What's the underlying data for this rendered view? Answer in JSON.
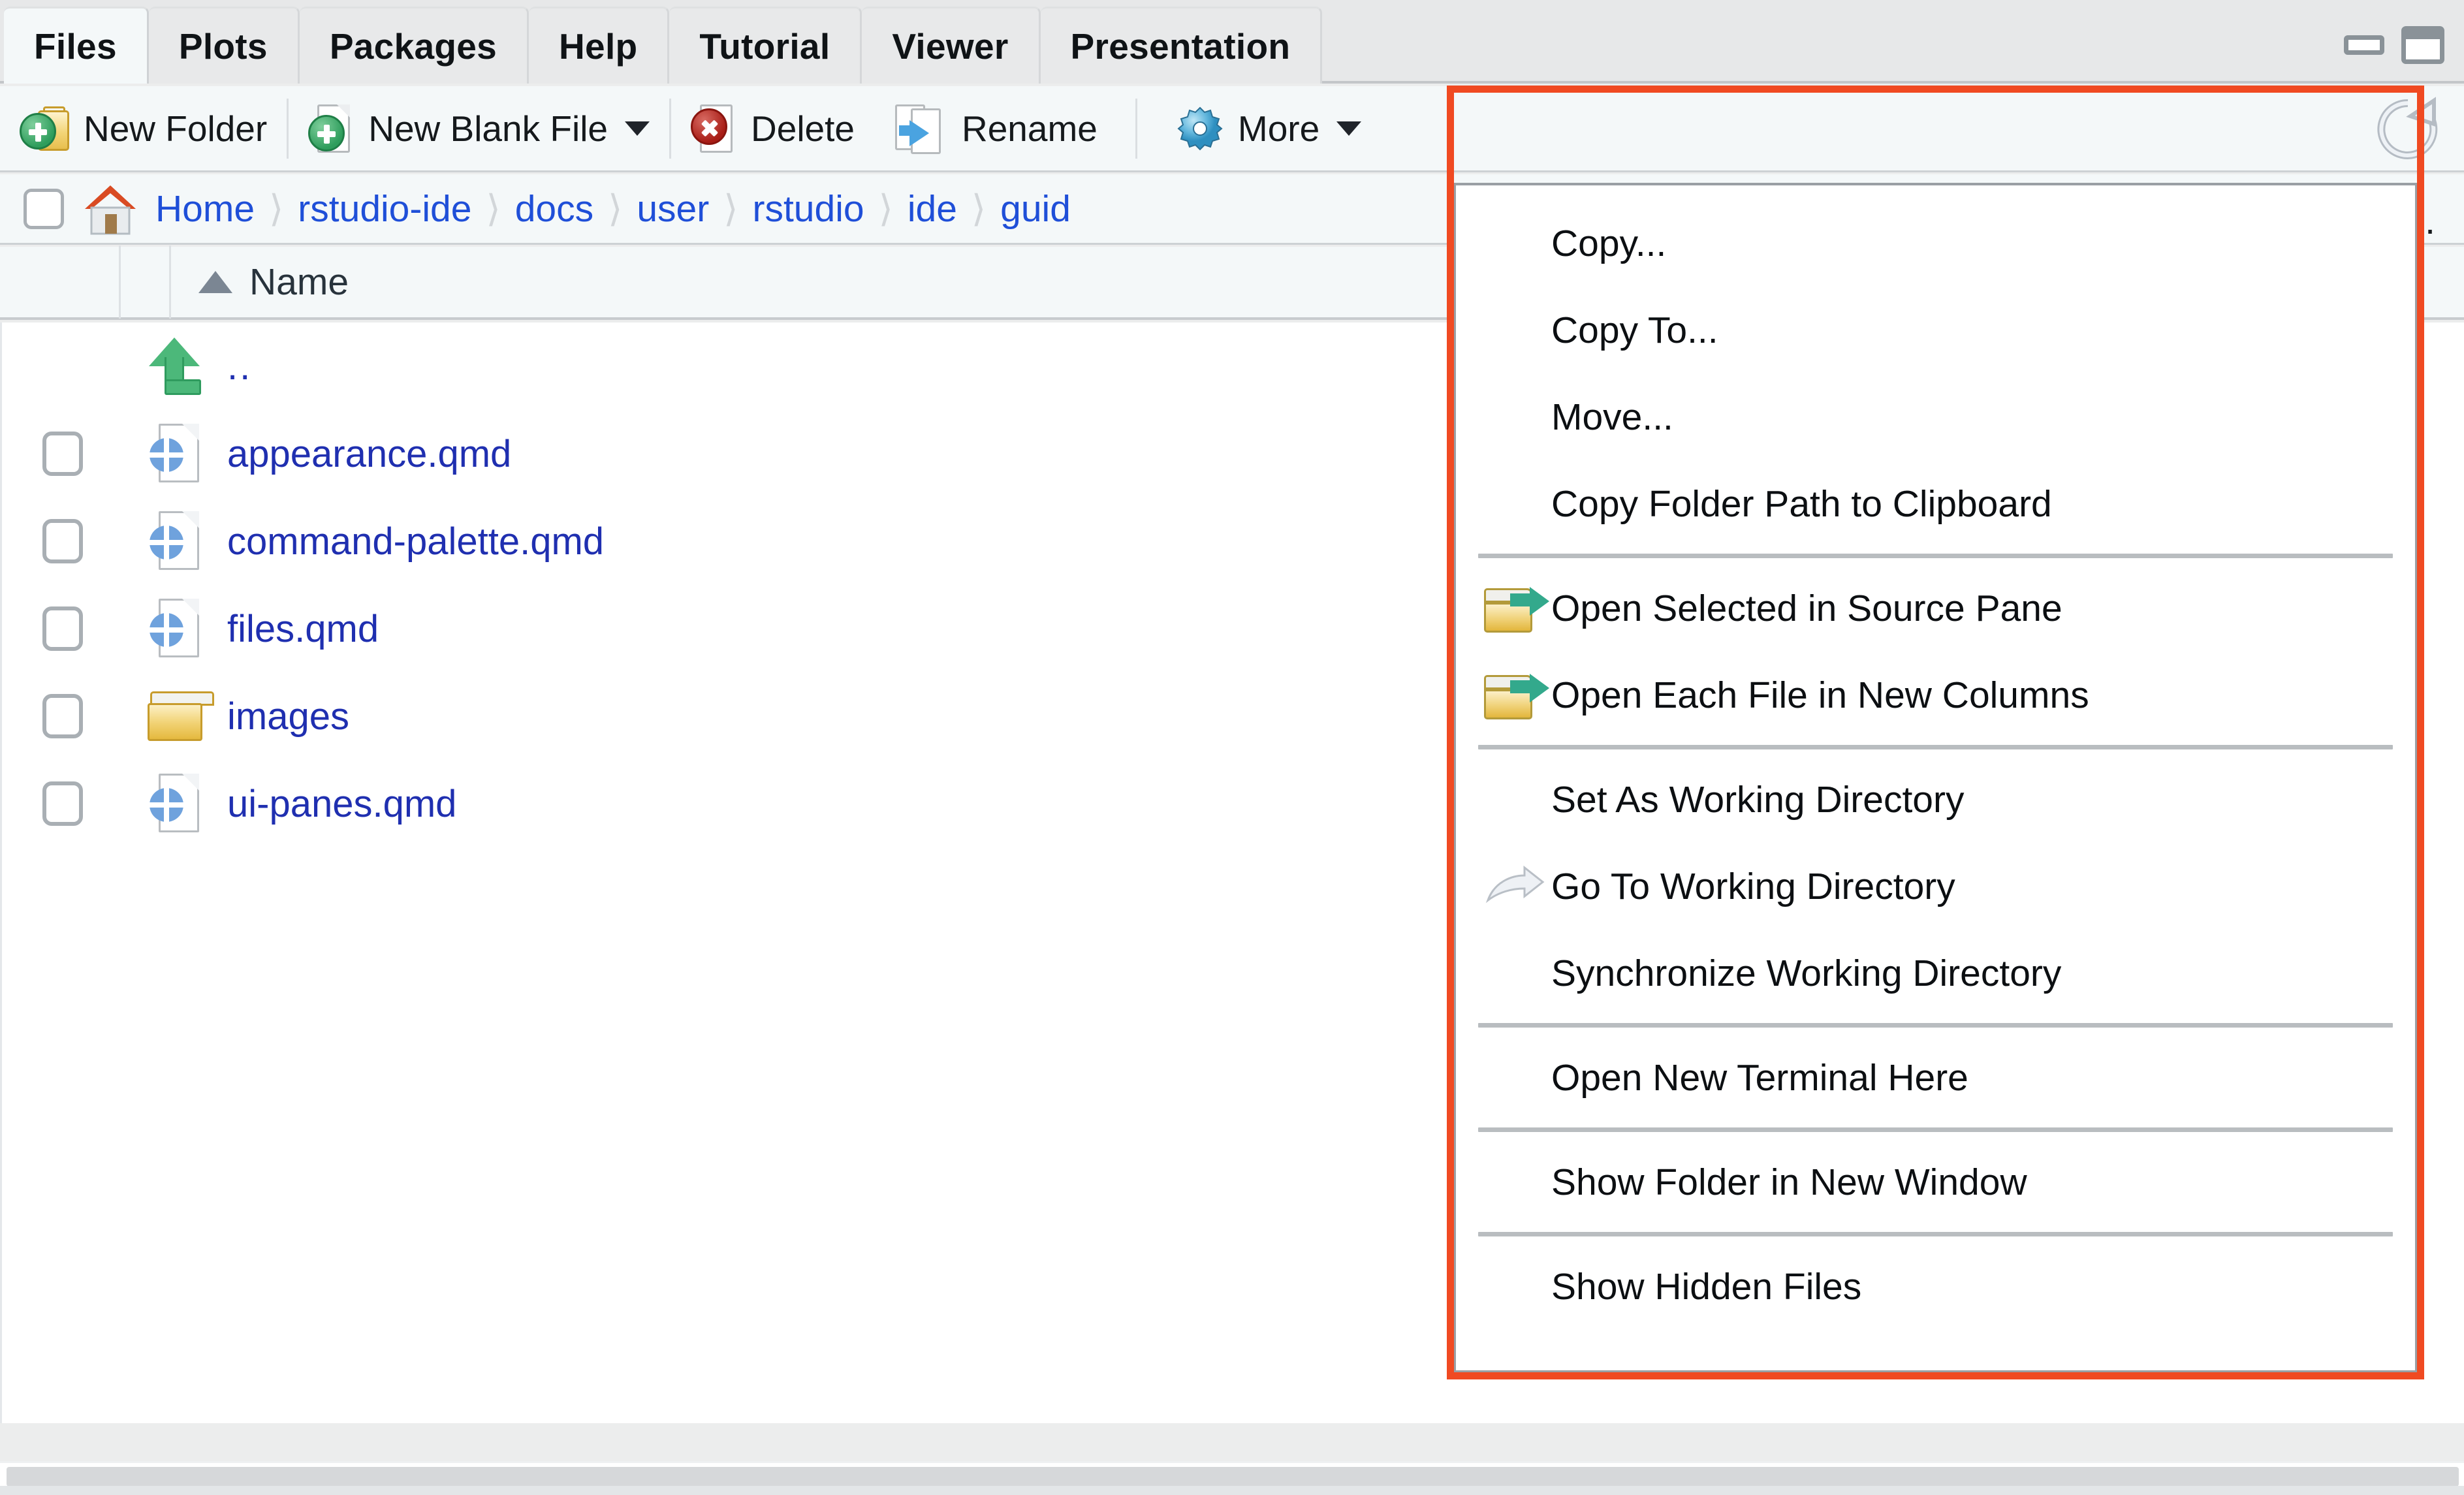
{
  "window": {
    "minimize_label": "minimize",
    "maximize_label": "maximize"
  },
  "tabs": [
    {
      "label": "Files",
      "active": true
    },
    {
      "label": "Plots",
      "active": false
    },
    {
      "label": "Packages",
      "active": false
    },
    {
      "label": "Help",
      "active": false
    },
    {
      "label": "Tutorial",
      "active": false
    },
    {
      "label": "Viewer",
      "active": false
    },
    {
      "label": "Presentation",
      "active": false
    }
  ],
  "toolbar": {
    "new_folder": "New Folder",
    "new_blank_file": "New Blank File",
    "delete": "Delete",
    "rename": "Rename",
    "more": "More",
    "refresh": "refresh-icon"
  },
  "breadcrumb": {
    "home_icon": "home-icon",
    "items": [
      "Home",
      "rstudio-ide",
      "docs",
      "user",
      "rstudio",
      "ide",
      "guid"
    ],
    "separator": "〉",
    "overflow": "..."
  },
  "columns": {
    "name": "Name",
    "sort_direction": "ascending"
  },
  "files": [
    {
      "name": "..",
      "icon": "up-arrow-icon",
      "checkbox": false
    },
    {
      "name": "appearance.qmd",
      "icon": "qmd-file-icon",
      "checkbox": true
    },
    {
      "name": "command-palette.qmd",
      "icon": "qmd-file-icon",
      "checkbox": true
    },
    {
      "name": "files.qmd",
      "icon": "qmd-file-icon",
      "checkbox": true
    },
    {
      "name": "images",
      "icon": "folder-icon",
      "checkbox": true
    },
    {
      "name": "ui-panes.qmd",
      "icon": "qmd-file-icon",
      "checkbox": true
    }
  ],
  "more_menu": {
    "groups": [
      {
        "items": [
          {
            "label": "Copy...",
            "icon": null
          },
          {
            "label": "Copy To...",
            "icon": null
          },
          {
            "label": "Move...",
            "icon": null
          },
          {
            "label": "Copy Folder Path to Clipboard",
            "icon": null
          }
        ]
      },
      {
        "items": [
          {
            "label": "Open Selected in Source Pane",
            "icon": "open-folder-arrow-icon"
          },
          {
            "label": "Open Each File in New Columns",
            "icon": "open-folder-arrow-icon"
          }
        ]
      },
      {
        "items": [
          {
            "label": "Set As Working Directory",
            "icon": null
          },
          {
            "label": "Go To Working Directory",
            "icon": "grey-arrow-icon"
          },
          {
            "label": "Synchronize Working Directory",
            "icon": null
          }
        ]
      },
      {
        "items": [
          {
            "label": "Open New Terminal Here",
            "icon": null
          }
        ]
      },
      {
        "items": [
          {
            "label": "Show Folder in New Window",
            "icon": null
          }
        ]
      },
      {
        "items": [
          {
            "label": "Show Hidden Files",
            "icon": null
          }
        ]
      }
    ]
  },
  "colors": {
    "highlight": "#f04a22",
    "link": "#1f2fb0",
    "breadcrumb_link": "#1f4fd8",
    "tab_active_bg": "#f4f8f9",
    "toolbar_bg": "#f4f8f9"
  }
}
